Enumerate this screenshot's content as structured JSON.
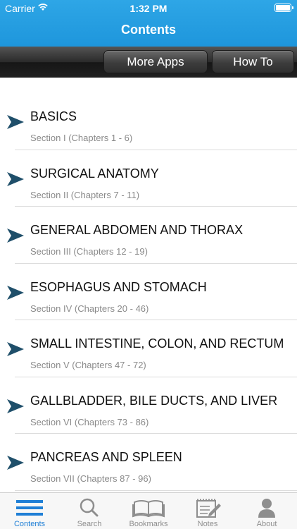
{
  "status_bar": {
    "carrier": "Carrier",
    "time": "1:32 PM"
  },
  "nav": {
    "title": "Contents"
  },
  "toolbar": {
    "more_apps_label": "More Apps",
    "how_to_label": "How To"
  },
  "sections": [
    {
      "title": "BASICS",
      "subtitle": "Section I (Chapters 1 - 6)"
    },
    {
      "title": "SURGICAL ANATOMY",
      "subtitle": "Section II (Chapters 7 - 11)"
    },
    {
      "title": "GENERAL ABDOMEN AND THORAX",
      "subtitle": "Section III (Chapters 12 - 19)"
    },
    {
      "title": "ESOPHAGUS AND STOMACH",
      "subtitle": "Section IV (Chapters 20 - 46)"
    },
    {
      "title": "SMALL INTESTINE, COLON, AND RECTUM",
      "subtitle": "Section V (Chapters 47 - 72)"
    },
    {
      "title": "GALLBLADDER, BILE DUCTS, AND LIVER",
      "subtitle": "Section VI (Chapters 73 - 86)"
    },
    {
      "title": "PANCREAS AND SPLEEN",
      "subtitle": "Section VII (Chapters 87 - 96)"
    }
  ],
  "tab_bar": {
    "items": [
      {
        "label": "Contents",
        "icon": "list-icon",
        "active": true
      },
      {
        "label": "Search",
        "icon": "search-icon",
        "active": false
      },
      {
        "label": "Bookmarks",
        "icon": "book-icon",
        "active": false
      },
      {
        "label": "Notes",
        "icon": "notepad-icon",
        "active": false
      },
      {
        "label": "About",
        "icon": "person-icon",
        "active": false
      }
    ]
  },
  "colors": {
    "nav_blue": "#1e96dc",
    "active_tab": "#1f7fd6",
    "arrow": "#1f4f6a"
  }
}
